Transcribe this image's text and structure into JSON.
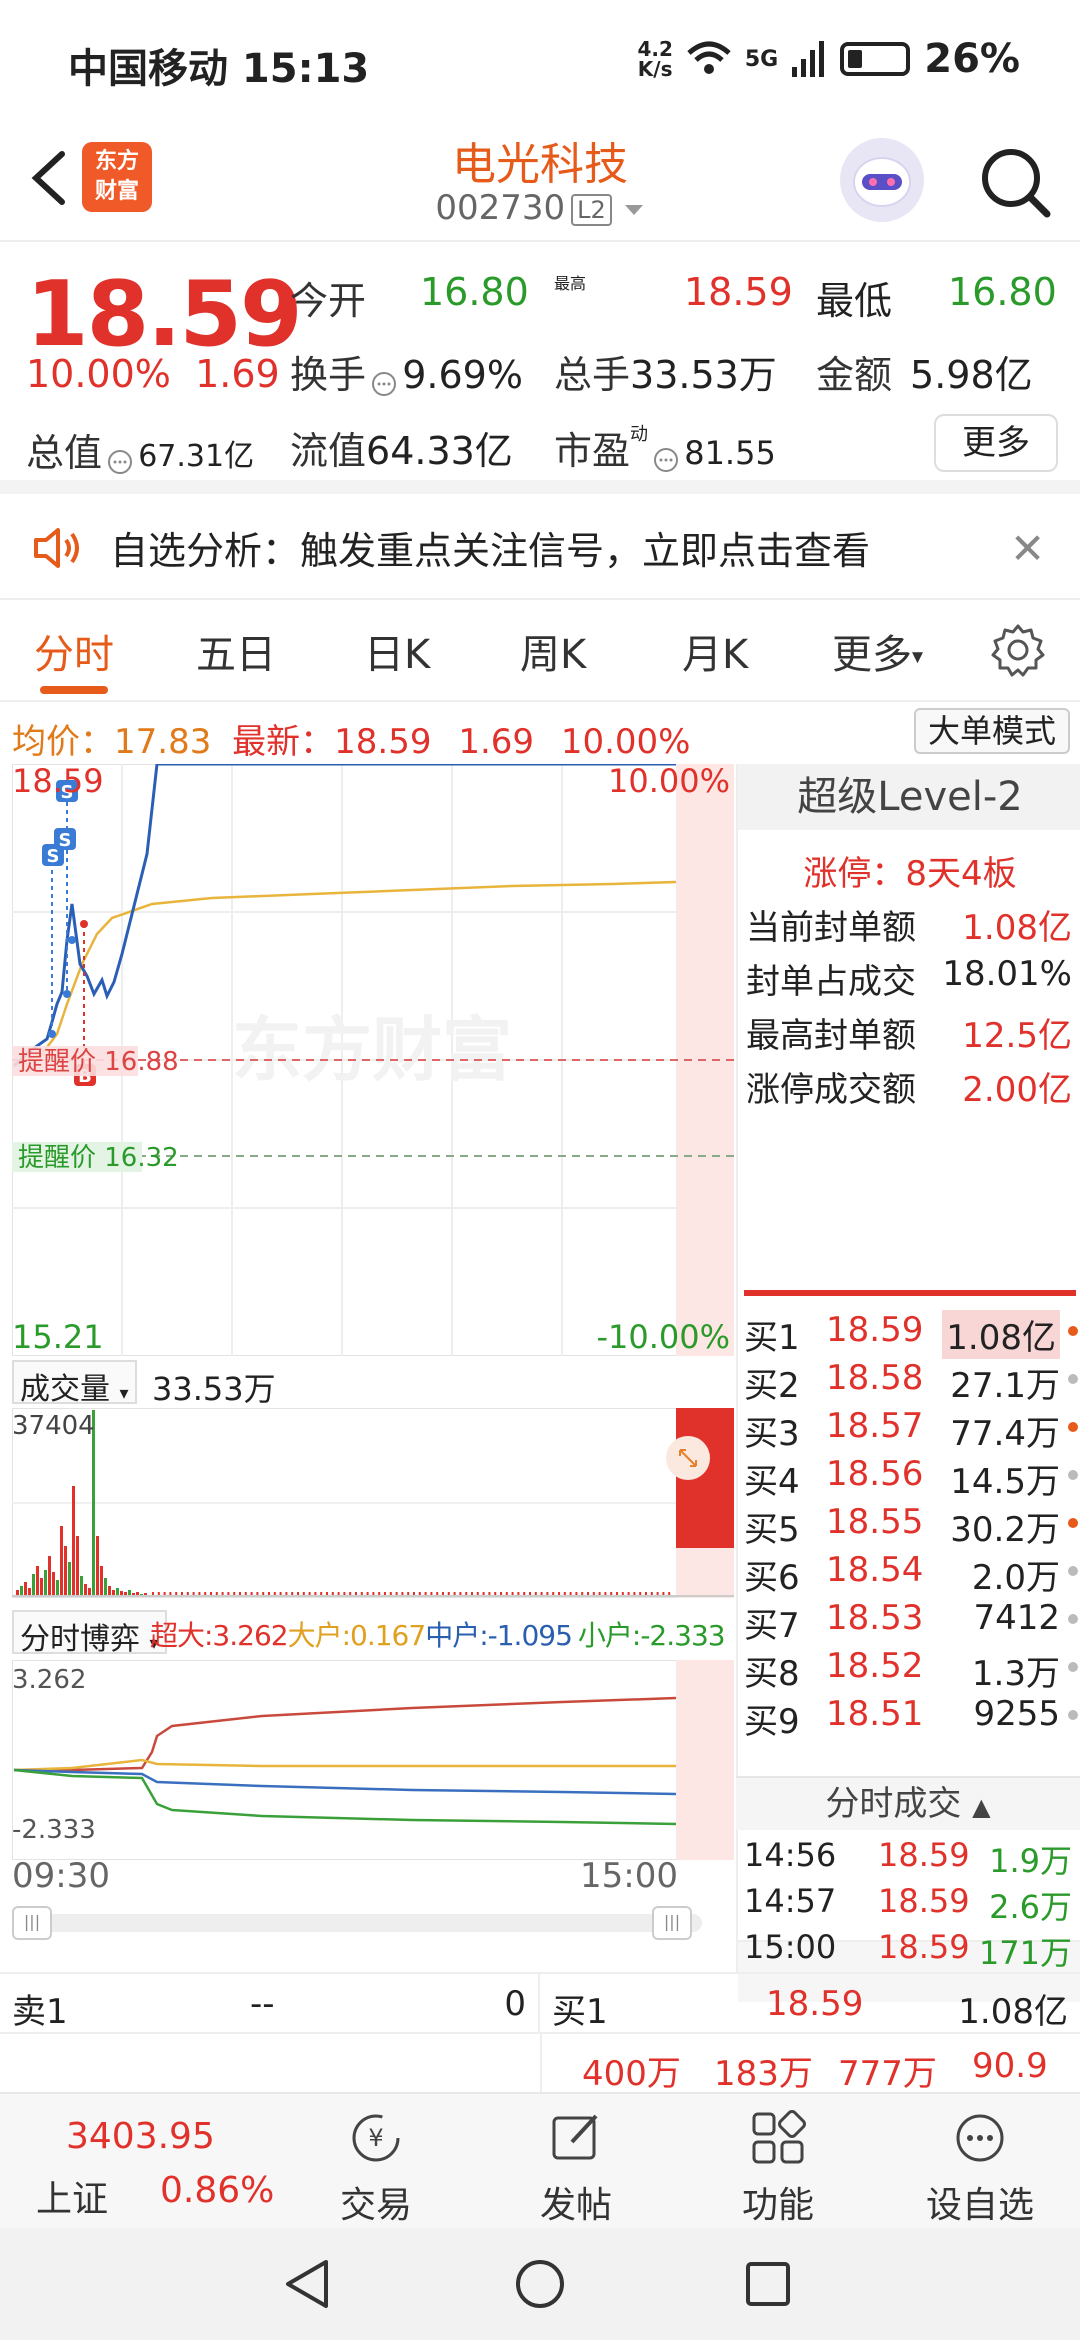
{
  "status": {
    "carrier": "中国移动 15:13",
    "speed_top": "4.2",
    "speed_bottom": "K/s",
    "network": "5G",
    "battery": "26%"
  },
  "header": {
    "logo_line1": "东方",
    "logo_line2": "财富",
    "stock_name": "电光科技",
    "stock_code": "002730",
    "level_badge": "L2"
  },
  "quote": {
    "price": "18.59",
    "change_pct": "10.00%",
    "change_amt": "1.69",
    "open_label": "今开",
    "open": "16.80",
    "high_label": "最高",
    "high": "18.59",
    "low_label": "最低",
    "low": "16.80",
    "turnover_label": "换手",
    "turnover": "9.69%",
    "volume_label": "总手",
    "volume": "33.53万",
    "amount_label": "金额",
    "amount": "5.98亿",
    "mktcap_label": "总值",
    "mktcap": "67.31亿",
    "float_label": "流值",
    "float": "64.33亿",
    "pe_label": "市盈",
    "pe_sup": "动",
    "pe": "81.55",
    "more": "更多"
  },
  "alert": {
    "text": "自选分析：触发重点关注信号，立即点击查看"
  },
  "tabs": [
    "分时",
    "五日",
    "日K",
    "周K",
    "月K",
    "更多"
  ],
  "infoline": {
    "avg_label": "均价：",
    "avg": "17.83",
    "last_label": "最新：",
    "last": "18.59",
    "chg": "1.69",
    "pct": "10.00%",
    "bigorder": "大单模式"
  },
  "chart": {
    "top_price": "18.59",
    "top_pct": "10.00%",
    "bottom_price": "15.21",
    "bottom_pct": "-10.00%",
    "watermark": "东方财富",
    "alert1": "提醒价 16.88",
    "alert2": "提醒价 16.32",
    "vol_label": "成交量",
    "vol_total": "33.53万",
    "vol_max": "37404",
    "game_label": "分时博弈",
    "game_super": "超大:3.262",
    "game_large": "大户:0.167",
    "game_mid": "中户:-1.095",
    "game_small": "小户:-2.333",
    "game_top": "3.262",
    "game_bottom": "-2.333",
    "time_start": "09:30",
    "time_end": "15:00",
    "marker_s": "S",
    "marker_b": "B"
  },
  "level2": {
    "title": "超级Level-2",
    "limit_up": "涨停：8天4板",
    "rows": [
      {
        "label": "当前封单额",
        "value": "1.08亿"
      },
      {
        "label": "封单占成交",
        "value": "18.01%"
      },
      {
        "label": "最高封单额",
        "value": "12.5亿"
      },
      {
        "label": "涨停成交额",
        "value": "2.00亿"
      }
    ]
  },
  "book": [
    {
      "label": "买1",
      "price": "18.59",
      "vol": "1.08亿"
    },
    {
      "label": "买2",
      "price": "18.58",
      "vol": "27.1万"
    },
    {
      "label": "买3",
      "price": "18.57",
      "vol": "77.4万"
    },
    {
      "label": "买4",
      "price": "18.56",
      "vol": "14.5万"
    },
    {
      "label": "买5",
      "price": "18.55",
      "vol": "30.2万"
    },
    {
      "label": "买6",
      "price": "18.54",
      "vol": "2.0万"
    },
    {
      "label": "买7",
      "price": "18.53",
      "vol": "7412"
    },
    {
      "label": "买8",
      "price": "18.52",
      "vol": "1.3万"
    },
    {
      "label": "买9",
      "price": "18.51",
      "vol": "9255"
    }
  ],
  "ticks": {
    "title": "分时成交",
    "rows": [
      {
        "time": "14:56",
        "price": "18.59",
        "vol": "1.9万"
      },
      {
        "time": "14:57",
        "price": "18.59",
        "vol": "2.6万"
      },
      {
        "time": "15:00",
        "price": "18.59",
        "vol": "171万"
      }
    ]
  },
  "bottombook": {
    "sell_label": "卖1",
    "sell_price": "--",
    "sell_vol": "0",
    "buy_label": "买1",
    "buy_price": "18.59",
    "buy_vol": "1.08亿",
    "flows": [
      "400万",
      "183万",
      "777万",
      "90.9万"
    ]
  },
  "nav": {
    "index_value": "3403.95",
    "index_name": "上证",
    "index_pct": "0.86%",
    "items": [
      "交易",
      "发帖",
      "功能",
      "设自选"
    ]
  }
}
